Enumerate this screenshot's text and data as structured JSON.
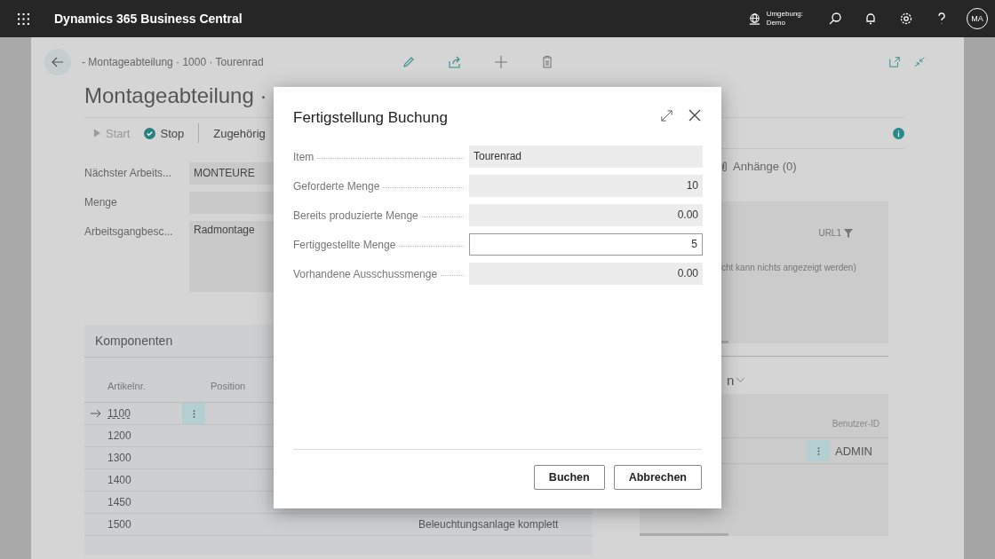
{
  "topbar": {
    "app_title": "Dynamics 365 Business Central",
    "environment_label": "Umgebung:",
    "environment_name": "Demo",
    "user_initials": "MA"
  },
  "page": {
    "breadcrumb": "- Montageabteilung · 1000 · Tourenrad",
    "title": "Montageabteilung ·",
    "actions": [
      {
        "label": "Start",
        "kind": "start",
        "disabled": true
      },
      {
        "label": "Stop",
        "kind": "stop",
        "disabled": false
      },
      {
        "label": "Zugehörig",
        "kind": "menu",
        "disabled": false
      }
    ],
    "fields": [
      {
        "label": "Nächster Arbeits...",
        "value": "MONTEURE",
        "kind": "text"
      },
      {
        "label": "Menge",
        "kind": "text"
      },
      {
        "label": "Arbeitsgangbesc...",
        "value": "Radmontage",
        "kind": "multiline"
      }
    ],
    "components": {
      "title": "Komponenten",
      "columns": [
        "Artikelnr.",
        "Position"
      ],
      "rows": [
        {
          "item_no": "1100",
          "selected": true
        },
        {
          "item_no": "1200",
          "selected": false
        },
        {
          "item_no": "1300",
          "selected": false
        },
        {
          "item_no": "1400",
          "selected": false
        },
        {
          "item_no": "1450",
          "selected": false
        },
        {
          "item_no": "1500",
          "column_3": "Beleuchtungsanlage komplett",
          "selected": false
        }
      ]
    }
  },
  "factbox": {
    "attachments": "Anhänge (0)",
    "link_filter": "URL1",
    "message": "cht kann nichts angezeigt werden)",
    "section_title": "n",
    "column": "Benutzer-ID",
    "rows": [
      "ADMIN"
    ]
  },
  "dialog": {
    "title": "Fertigstellung Buchung",
    "fields": [
      {
        "label": "Item",
        "value": "Tourenrad",
        "editable": false,
        "kind": "text"
      },
      {
        "label": "Geforderte Menge",
        "value": "10",
        "editable": false,
        "kind": "number"
      },
      {
        "label": "Bereits produzierte Menge",
        "value": "0.00",
        "editable": false,
        "kind": "number"
      },
      {
        "label": "Fertiggestellte Menge",
        "value": "5",
        "editable": true,
        "kind": "number"
      },
      {
        "label": "Vorhandene Ausschussmenge",
        "value": "0.00",
        "editable": false,
        "kind": "number"
      }
    ],
    "buttons": [
      "Buchen",
      "Abbrechen"
    ]
  }
}
